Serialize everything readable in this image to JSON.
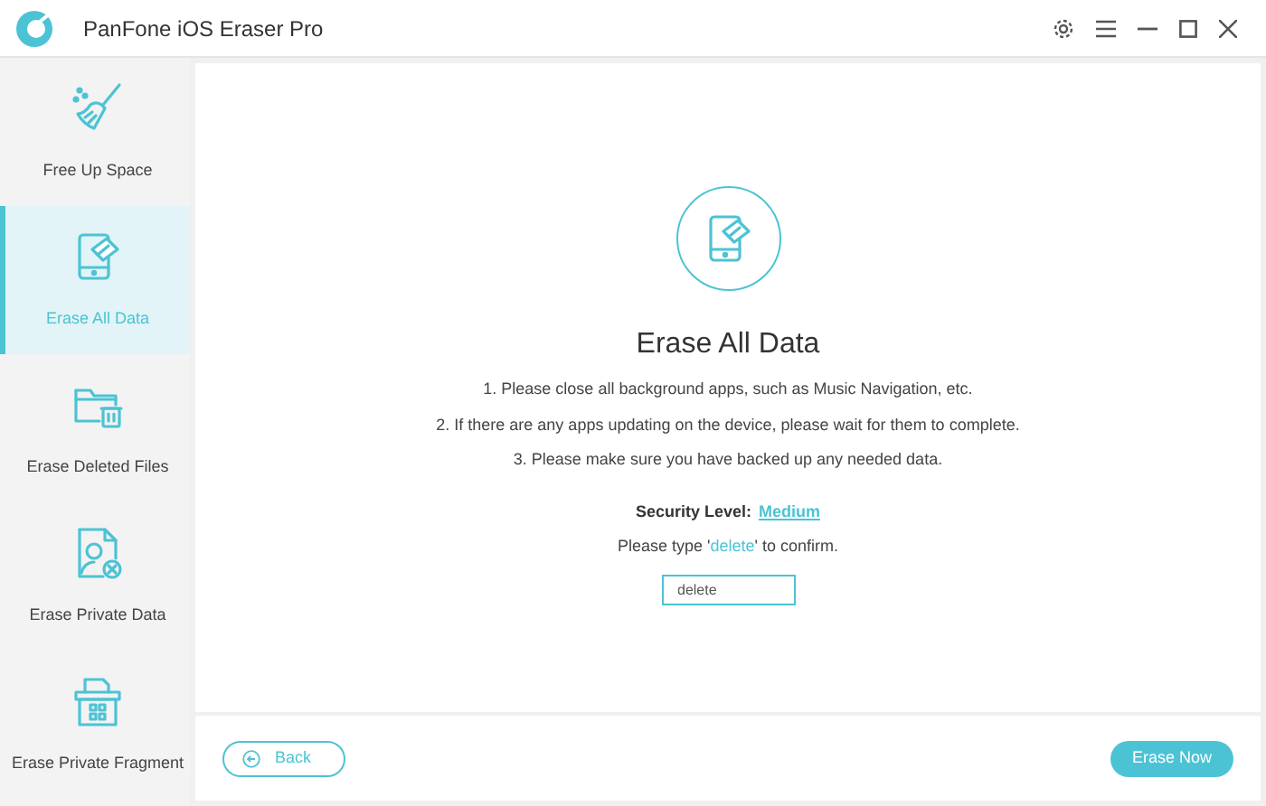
{
  "window": {
    "title": "PanFone iOS Eraser Pro"
  },
  "sidebar": {
    "items": [
      {
        "label": "Free Up Space",
        "kind": "broom",
        "selected": false
      },
      {
        "label": "Erase All Data",
        "kind": "phone",
        "selected": true
      },
      {
        "label": "Erase Deleted Files",
        "kind": "folder",
        "selected": false
      },
      {
        "label": "Erase Private Data",
        "kind": "person",
        "selected": false
      },
      {
        "label": "Erase Private Fragment",
        "kind": "box",
        "selected": false
      }
    ]
  },
  "main": {
    "title": "Erase All Data",
    "instructions": [
      "1. Please close all background apps, such as Music Navigation, etc.",
      "2. If there are any apps updating on the device, please wait for them to complete.",
      "3. Please make sure you have backed up any needed data."
    ],
    "security": {
      "label": "Security Level:",
      "value": "Medium"
    },
    "confirm": {
      "before": "Please type '",
      "keyword": "delete",
      "after": "' to confirm."
    },
    "input": {
      "value": "delete"
    }
  },
  "footer": {
    "back": "Back",
    "erase": "Erase Now"
  }
}
